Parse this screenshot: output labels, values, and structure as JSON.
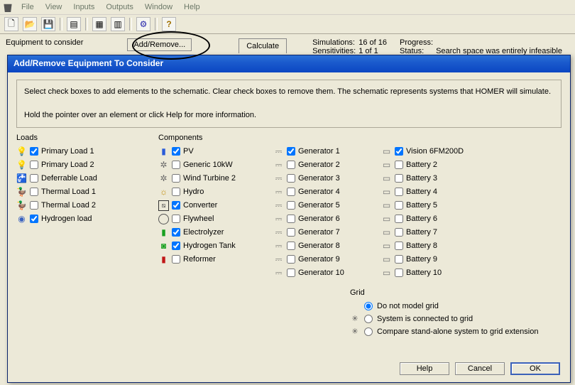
{
  "menu": [
    "File",
    "View",
    "Inputs",
    "Outputs",
    "Window",
    "Help"
  ],
  "topstrip": {
    "equipment_label": "Equipment to consider",
    "addremove_label": "Add/Remove...",
    "calculate_label": "Calculate",
    "simulations_label": "Simulations:",
    "simulations_value": "16 of 16",
    "sensitivities_label": "Sensitivities:",
    "sensitivities_value": "1 of 1",
    "progress_label": "Progress:",
    "status_label": "Status:",
    "status_value": "Search space was entirely infeasible"
  },
  "modal": {
    "title": "Add/Remove Equipment To Consider",
    "info1": "Select check boxes to add elements to the schematic. Clear check boxes to remove them. The schematic represents systems that HOMER will simulate.",
    "info2": "Hold the pointer over an element or click Help for more information."
  },
  "loads_title": "Loads",
  "loads": [
    {
      "label": "Primary Load 1",
      "checked": true,
      "icon": "bulb"
    },
    {
      "label": "Primary Load 2",
      "checked": false,
      "icon": "bulb-off"
    },
    {
      "label": "Deferrable Load",
      "checked": false,
      "icon": "tap"
    },
    {
      "label": "Thermal Load 1",
      "checked": false,
      "icon": "duck"
    },
    {
      "label": "Thermal Load 2",
      "checked": false,
      "icon": "duck"
    },
    {
      "label": "Hydrogen load",
      "checked": true,
      "icon": "h2o"
    }
  ],
  "components_title": "Components",
  "components_col1": [
    {
      "label": "PV",
      "checked": true,
      "icon": "pv"
    },
    {
      "label": "Generic 10kW",
      "checked": false,
      "icon": "wind"
    },
    {
      "label": "Wind Turbine 2",
      "checked": false,
      "icon": "wind"
    },
    {
      "label": "Hydro",
      "checked": false,
      "icon": "hydro"
    },
    {
      "label": "Converter",
      "checked": true,
      "icon": "conv"
    },
    {
      "label": "Flywheel",
      "checked": false,
      "icon": "fly"
    },
    {
      "label": "Electrolyzer",
      "checked": true,
      "icon": "elec"
    },
    {
      "label": "Hydrogen Tank",
      "checked": true,
      "icon": "tank"
    },
    {
      "label": "Reformer",
      "checked": false,
      "icon": "ref"
    }
  ],
  "components_col2": [
    {
      "label": "Generator 1",
      "checked": true,
      "icon": "gen"
    },
    {
      "label": "Generator 2",
      "checked": false,
      "icon": "gen"
    },
    {
      "label": "Generator 3",
      "checked": false,
      "icon": "gen"
    },
    {
      "label": "Generator 4",
      "checked": false,
      "icon": "gen"
    },
    {
      "label": "Generator 5",
      "checked": false,
      "icon": "gen"
    },
    {
      "label": "Generator 6",
      "checked": false,
      "icon": "gen"
    },
    {
      "label": "Generator 7",
      "checked": false,
      "icon": "gen"
    },
    {
      "label": "Generator 8",
      "checked": false,
      "icon": "gen"
    },
    {
      "label": "Generator 9",
      "checked": false,
      "icon": "gen"
    },
    {
      "label": "Generator 10",
      "checked": false,
      "icon": "gen"
    }
  ],
  "components_col3": [
    {
      "label": "Vision 6FM200D",
      "checked": true,
      "icon": "batt"
    },
    {
      "label": "Battery 2",
      "checked": false,
      "icon": "batt"
    },
    {
      "label": "Battery 3",
      "checked": false,
      "icon": "batt"
    },
    {
      "label": "Battery 4",
      "checked": false,
      "icon": "batt"
    },
    {
      "label": "Battery 5",
      "checked": false,
      "icon": "batt"
    },
    {
      "label": "Battery 6",
      "checked": false,
      "icon": "batt"
    },
    {
      "label": "Battery 7",
      "checked": false,
      "icon": "batt"
    },
    {
      "label": "Battery 8",
      "checked": false,
      "icon": "batt"
    },
    {
      "label": "Battery 9",
      "checked": false,
      "icon": "batt"
    },
    {
      "label": "Battery 10",
      "checked": false,
      "icon": "batt"
    }
  ],
  "grid_title": "Grid",
  "grid_options": [
    {
      "label": "Do not model grid",
      "checked": true,
      "icon": ""
    },
    {
      "label": "System is connected to grid",
      "checked": false,
      "icon": "grid"
    },
    {
      "label": "Compare stand-alone system to grid extension",
      "checked": false,
      "icon": "grid"
    }
  ],
  "buttons": {
    "help": "Help",
    "cancel": "Cancel",
    "ok": "OK"
  }
}
